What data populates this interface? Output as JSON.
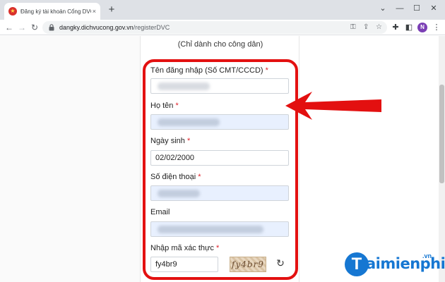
{
  "browser": {
    "tab_title": "Đăng ký tài khoản Cổng DVC qu",
    "tab_close": "×",
    "new_tab": "+",
    "url_domain": "dangky.dichvucong.gov.vn",
    "url_path": "/registerDVC",
    "profile_initial": "N"
  },
  "form": {
    "subtitle": "(Chỉ dành cho công dân)",
    "required_mark": "*",
    "fields": [
      {
        "label": "Tên đăng nhập (Số CMT/CCCD)",
        "value": ""
      },
      {
        "label": "Họ tên",
        "value": ""
      },
      {
        "label": "Ngày sinh",
        "value": "02/02/2000"
      },
      {
        "label": "Số điện thoại",
        "value": ""
      },
      {
        "label": "Email",
        "value": ""
      },
      {
        "label": "Nhập mã xác thực",
        "value": "fy4br9"
      }
    ],
    "captcha_text": "fy4br9"
  },
  "watermark": {
    "letter": "T",
    "text": "aimienphi",
    "suffix": ".vn"
  },
  "colors": {
    "highlight": "#e31010",
    "autofill": "#e8f0fe",
    "watermark": "#1677d2"
  }
}
